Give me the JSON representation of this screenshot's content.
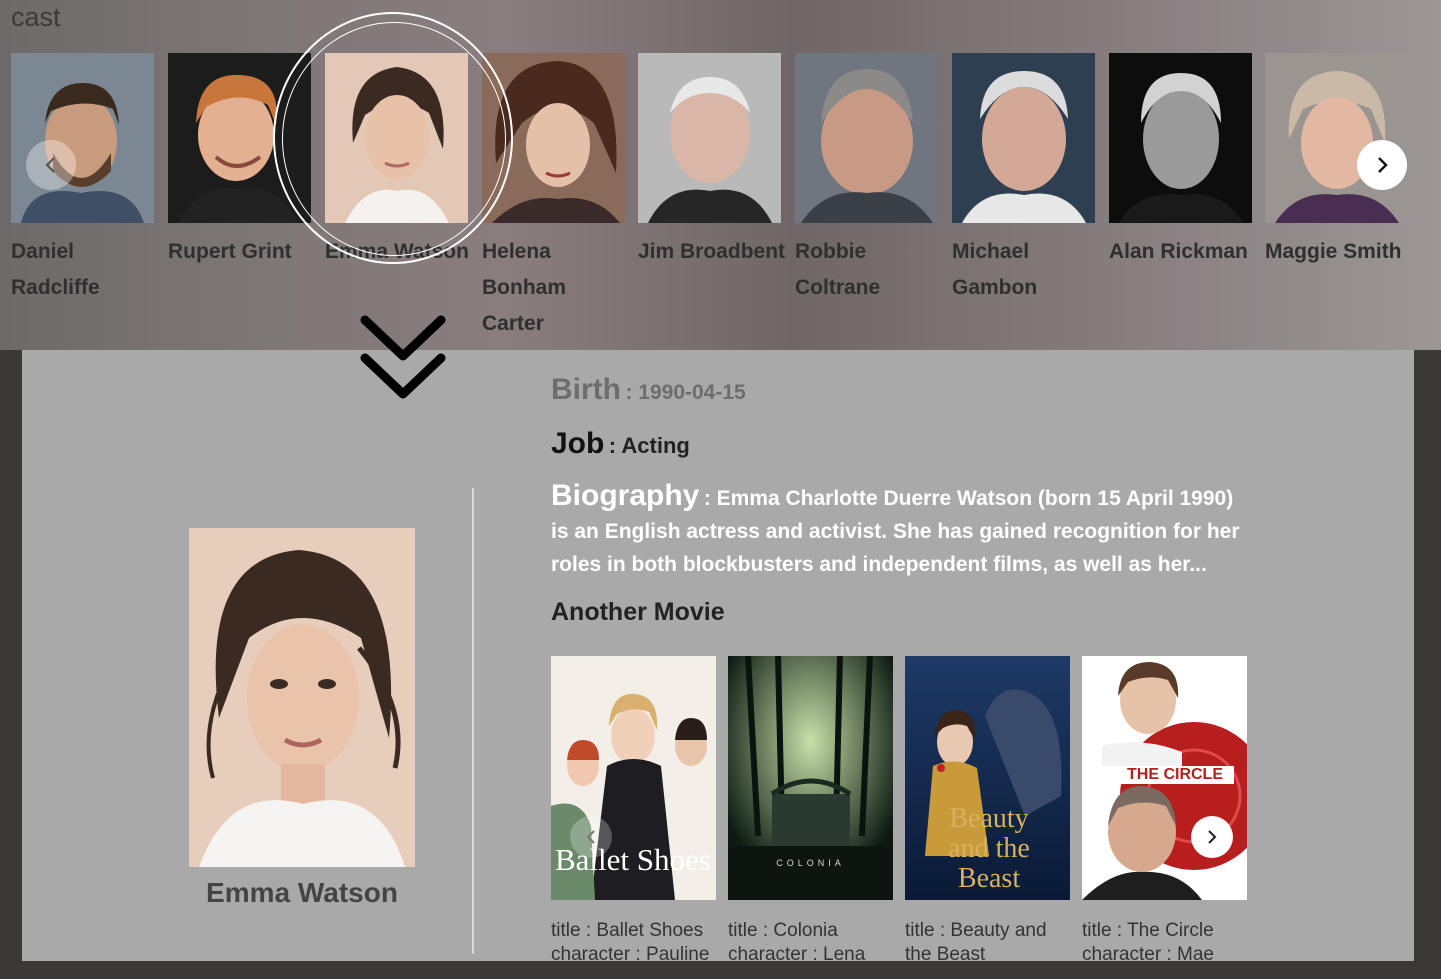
{
  "cast_section": {
    "title": "cast",
    "members": [
      {
        "name": "Daniel Radcliffe"
      },
      {
        "name": "Rupert Grint"
      },
      {
        "name": "Emma Watson"
      },
      {
        "name": "Helena Bonham Carter"
      },
      {
        "name": "Jim Broadbent"
      },
      {
        "name": "Robbie Coltrane"
      },
      {
        "name": "Michael Gambon"
      },
      {
        "name": "Alan Rickman"
      },
      {
        "name": "Maggie Smith"
      }
    ],
    "prev_icon": "chevron-left-icon",
    "next_icon": "chevron-right-icon",
    "selected": "Emma Watson"
  },
  "detail": {
    "arrow_icon": "double-chevron-down-icon",
    "profile_name": "Emma Watson",
    "birth_label": "Birth",
    "birth_value": ": 1990-04-15",
    "job_label": "Job",
    "job_value": ": Acting",
    "biography_label": "Biography",
    "biography_value": ": Emma Charlotte Duerre Watson (born 15 April 1990) is an English actress and activist. She has gained recognition for her roles in both blockbusters and independent films, as well as her...",
    "another_movie_heading": "Another Movie",
    "movies": [
      {
        "poster_text": "Ballet Shoes",
        "title": "title : Ballet Shoes",
        "character": "character : Pauline"
      },
      {
        "poster_text": "COLONIA",
        "title": "title : Colonia",
        "character": "character : Lena"
      },
      {
        "poster_text": "Beauty and the Beast",
        "poster_sub": "AND THE",
        "title": "title : Beauty and the Beast",
        "character": ""
      },
      {
        "poster_text": "THE CIRCLE",
        "title": "title : The Circle",
        "character": "character : Mae"
      }
    ]
  },
  "colors": {
    "panel_bg": "#a9a9a9",
    "page_bg": "#3c3838",
    "bio_text": "#ffffff"
  }
}
